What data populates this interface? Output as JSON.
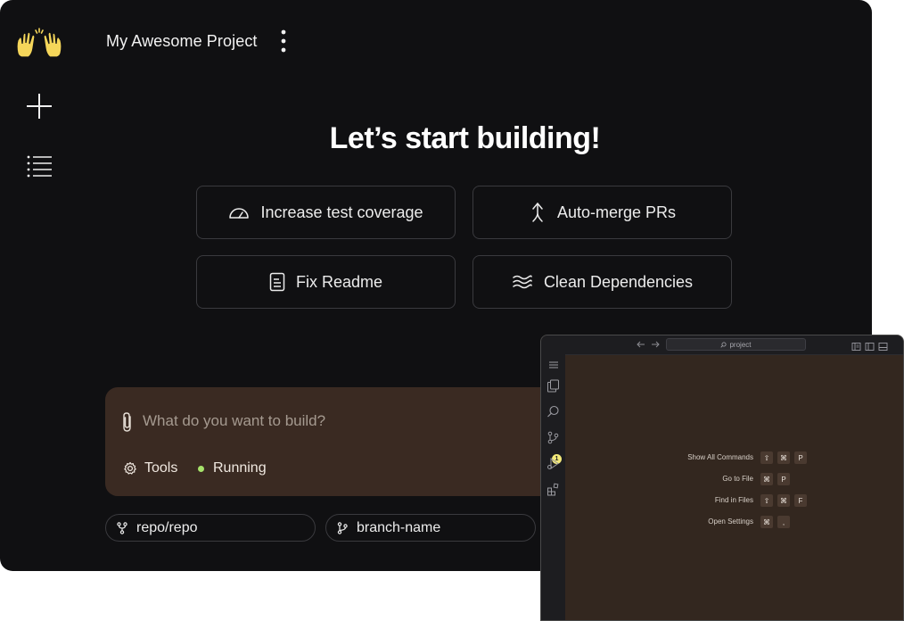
{
  "app": {
    "project_title": "My Awesome Project",
    "hero_title": "Let’s start building!"
  },
  "suggestions": [
    {
      "label": "Increase test coverage",
      "icon": "gauge-icon"
    },
    {
      "label": "Auto-merge PRs",
      "icon": "merge-arrow-icon"
    },
    {
      "label": "Fix Readme",
      "icon": "document-icon"
    },
    {
      "label": "Clean Dependencies",
      "icon": "waves-icon"
    }
  ],
  "composer": {
    "placeholder": "What do you want to build?",
    "tools_label": "Tools",
    "status_label": "Running",
    "status_color": "#a6e36b"
  },
  "repo": {
    "repo_label": "repo/repo",
    "branch_label": "branch-name"
  },
  "editor": {
    "search_label": "project",
    "scm_badge": "1",
    "shortcuts": [
      {
        "label": "Show All Commands",
        "keys": [
          "⇧",
          "⌘",
          "P"
        ]
      },
      {
        "label": "Go to File",
        "keys": [
          "⌘",
          "P"
        ]
      },
      {
        "label": "Find in Files",
        "keys": [
          "⇧",
          "⌘",
          "F"
        ]
      },
      {
        "label": "Open Settings",
        "keys": [
          "⌘",
          ","
        ]
      }
    ]
  },
  "colors": {
    "background": "#101012",
    "composer": "#3a2a22",
    "editor_bg": "#33271f",
    "logo": "#f5d65a"
  }
}
